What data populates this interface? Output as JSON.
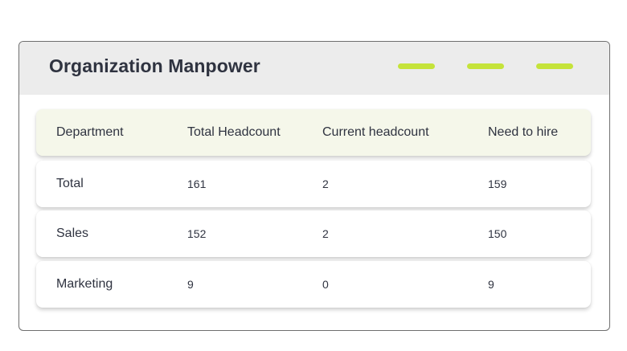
{
  "card": {
    "title": "Organization Manpower",
    "accent_color": "#c5e33a",
    "header_bg": "#ececec"
  },
  "table": {
    "columns": [
      "Department",
      "Total Headcount",
      "Current headcount",
      "Need to hire"
    ],
    "rows": [
      [
        "Total",
        "161",
        "2",
        "159"
      ],
      [
        "Sales",
        "152",
        "2",
        "150"
      ],
      [
        "Marketing",
        "9",
        "0",
        "9"
      ]
    ]
  }
}
